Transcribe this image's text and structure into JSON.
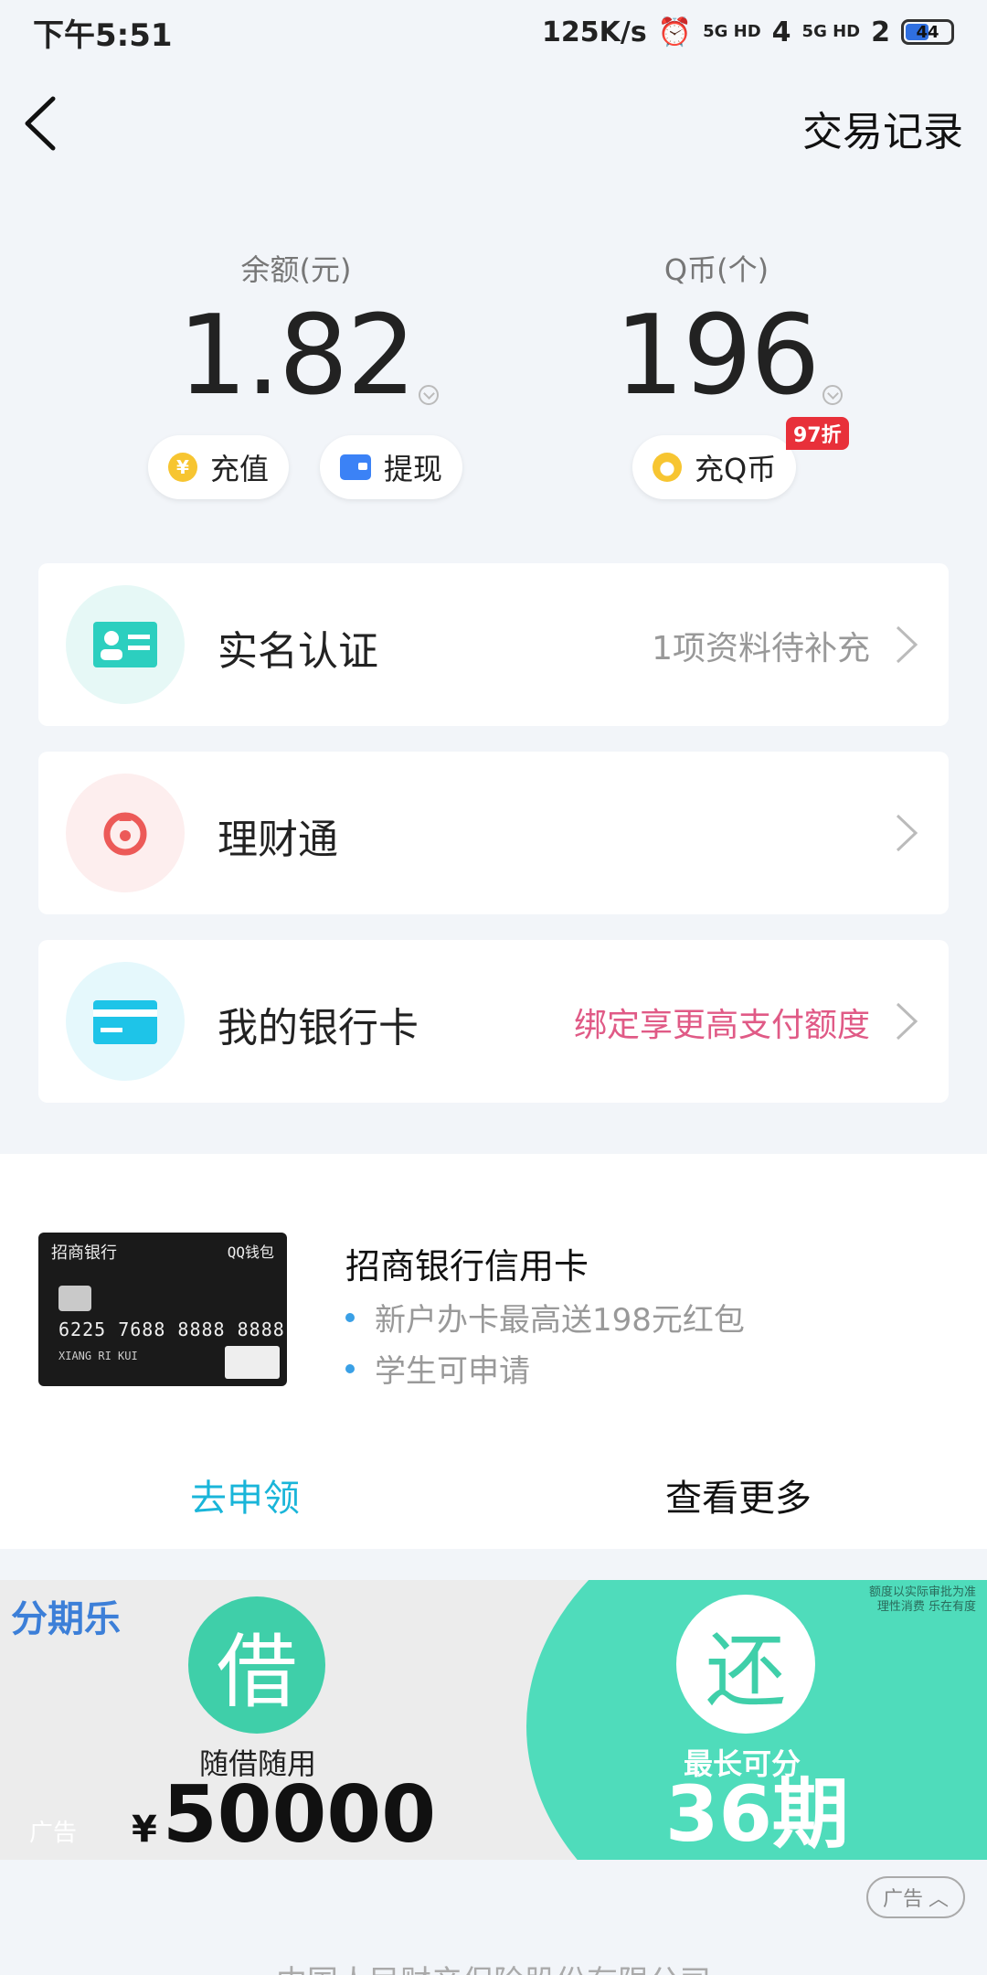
{
  "status": {
    "time": "下午5:51",
    "speed": "125K/s",
    "sim1": "5G HD",
    "sim1_sub": "4",
    "sim2": "5G HD",
    "sim2_sub": "2",
    "battery": "44"
  },
  "header": {
    "transactions_label": "交易记录"
  },
  "balance": {
    "label": "余额(元)",
    "value": "1.82",
    "recharge_label": "充值",
    "withdraw_label": "提现"
  },
  "qcoin": {
    "label": "Q币(个)",
    "value": "196",
    "recharge_label": "充Q币",
    "discount_badge": "97折"
  },
  "menu": {
    "realname": {
      "title": "实名认证",
      "sub": "1项资料待补充"
    },
    "licaitong": {
      "title": "理财通",
      "sub": ""
    },
    "bankcard": {
      "title": "我的银行卡",
      "sub": "绑定享更高支付额度"
    }
  },
  "promo": {
    "card_bank": "招商银行",
    "card_brand": "QQ钱包",
    "card_number": "6225 7688 8888 8888",
    "card_name": "XIANG RI KUI",
    "title": "招商银行信用卡",
    "bullets": [
      "新户办卡最高送198元红包",
      "学生可申请"
    ],
    "apply_label": "去申领",
    "more_label": "查看更多"
  },
  "ad": {
    "logo": "分期乐",
    "borrow_char": "借",
    "borrow_caption": "随借随用",
    "amount_currency": "¥",
    "amount": "50000",
    "repay_char": "还",
    "repay_caption": "最长可分",
    "periods": "36期",
    "disclaimer_line1": "额度以实际审批为准",
    "disclaimer_line2": "理性消费 乐在有度",
    "ad_label": "广告",
    "ad_pill_label": "广告"
  },
  "footer": {
    "company": "中国人民财产保险股份有限公司"
  },
  "colors": {
    "accent": "#19b5d9",
    "pink": "#e05a86",
    "teal": "#4fdcbb"
  }
}
